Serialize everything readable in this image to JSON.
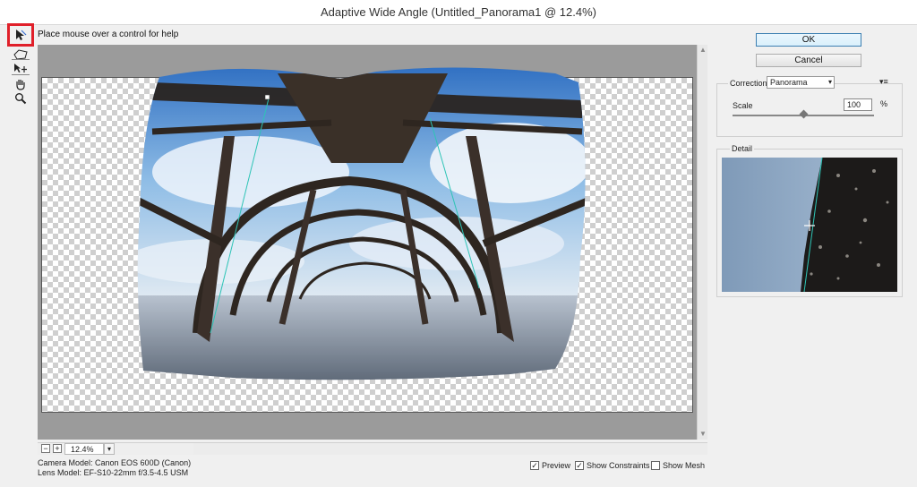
{
  "window": {
    "title": "Adaptive Wide Angle (Untitled_Panorama1 @ 12.4%)"
  },
  "toolbar": {
    "tools": [
      {
        "name": "constraint-tool",
        "icon": "constraint-arrow-icon",
        "active": true
      },
      {
        "name": "polygon-constraint-tool",
        "icon": "polygon-constraint-icon",
        "active": false
      },
      {
        "name": "move-tool",
        "icon": "move-icon",
        "active": false
      },
      {
        "name": "hand-tool",
        "icon": "hand-icon",
        "active": false
      },
      {
        "name": "zoom-tool",
        "icon": "zoom-icon",
        "active": false
      }
    ],
    "highlight_color": "#e0202a"
  },
  "hint": {
    "text": "Place mouse over a control for help"
  },
  "zoom": {
    "value": "12.4%",
    "minus": "−",
    "plus": "+"
  },
  "camera": {
    "model": "Camera Model: Canon EOS 600D (Canon)",
    "lens": "Lens Model: EF-S10-22mm f/3.5-4.5 USM"
  },
  "options": {
    "preview": {
      "label": "Preview",
      "checked": true
    },
    "show_constraints": {
      "label": "Show Constraints",
      "checked": true
    },
    "show_mesh": {
      "label": "Show Mesh",
      "checked": false
    }
  },
  "actions": {
    "ok": "OK",
    "cancel": "Cancel"
  },
  "correction": {
    "label": "Correction:",
    "selected": "Panorama",
    "menu_icon": "panel-menu-icon"
  },
  "scale": {
    "label": "Scale",
    "value": "100",
    "unit": "%",
    "level": 0.5
  },
  "detail": {
    "label": "Detail"
  }
}
